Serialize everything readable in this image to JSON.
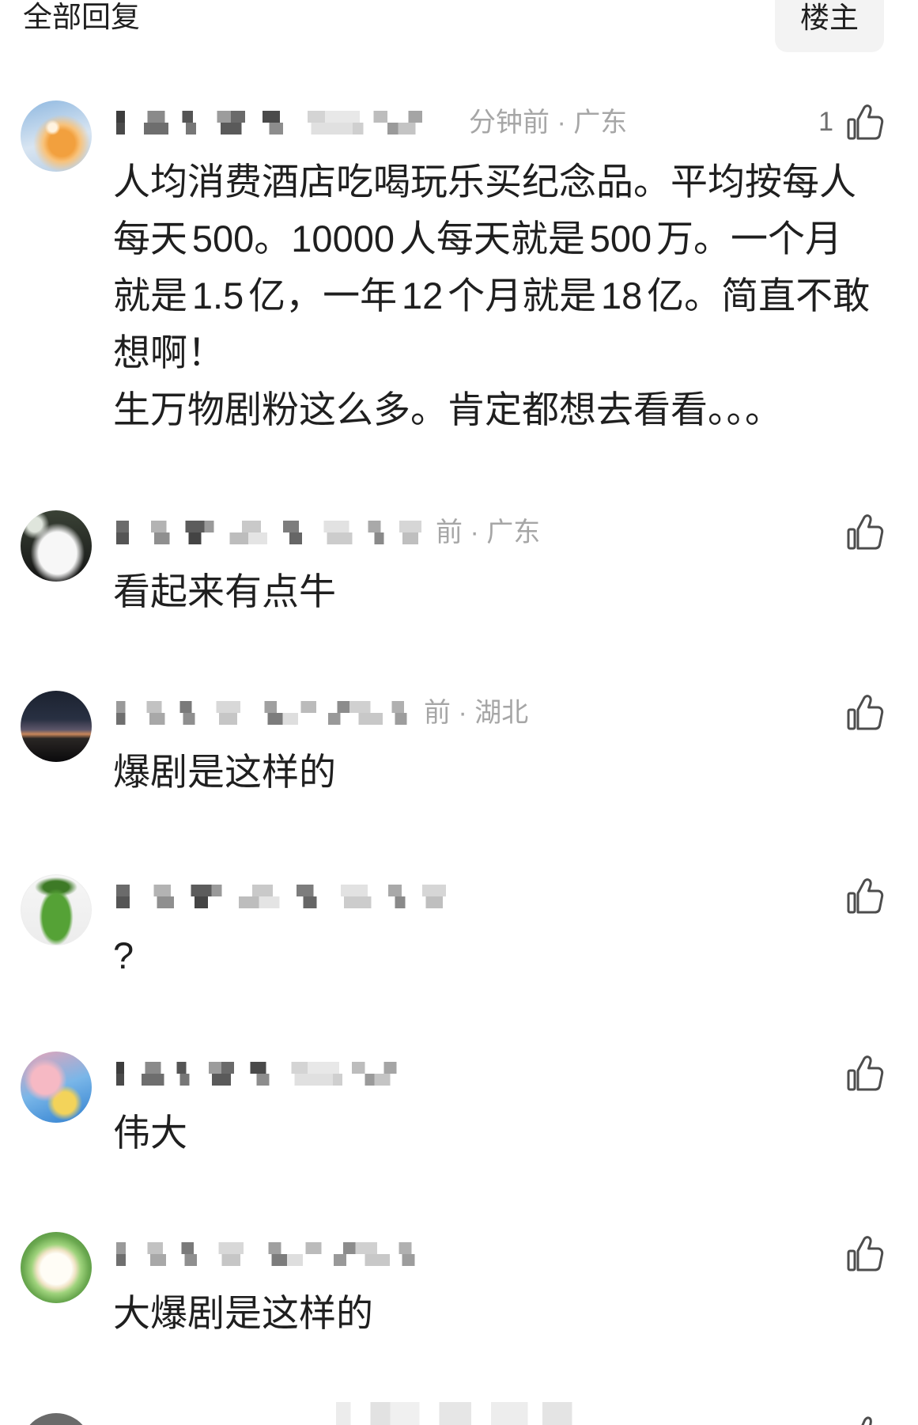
{
  "header": {
    "title": "全部回复",
    "op_button": "楼主"
  },
  "colors": {
    "text": "#1f1f1f",
    "meta": "#a6a6a6",
    "like_icon": "#4d4d4d",
    "button_bg": "#f3f3f3"
  },
  "icons": {
    "like": "thumbs-up-icon"
  },
  "comments": [
    {
      "meta": "分钟前 · 广东",
      "likes": "1",
      "body": [
        "人均消费酒店吃喝玩乐买纪念品。平均按每人",
        "每天500。10000人每天就是500万。一个月",
        "就是1.5亿，一年12个月就是18亿。简直不敢",
        "想啊！",
        "生万物剧粉这么多。肯定都想去看看。。。"
      ]
    },
    {
      "meta": "前 · 广东",
      "body": [
        "看起来有点牛"
      ]
    },
    {
      "meta": "前 · 湖北",
      "body": [
        "爆剧是这样的"
      ]
    },
    {
      "body": [
        "?"
      ]
    },
    {
      "body": [
        "伟大"
      ]
    },
    {
      "body": [
        "大爆剧是这样的"
      ]
    }
  ]
}
